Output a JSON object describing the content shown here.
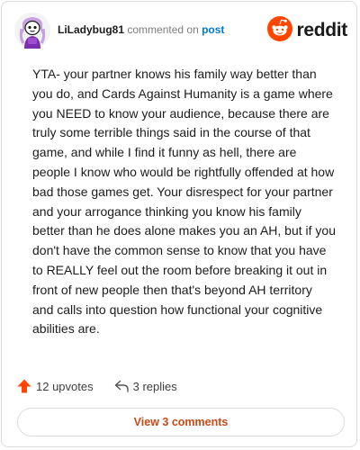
{
  "comment": {
    "username": "LiLadybug81",
    "action_text": "commented on",
    "post_link": "post",
    "text": "YTA- your partner knows his family way better than you do, and Cards Against Humanity is a game where you NEED to know your audience, because there are truly some terrible things said in the course of that game, and while I find it funny as hell, there are people I know who would be rightfully offended at how bad those games get. Your disrespect for your partner and your arrogance thinking you know his family better than he does alone makes you an AH, but if you don't have the common sense to know that you have to REALLY feel out the room before breaking it out in front of new people then that's beyond AH territory and calls into question how functional your cognitive abilities are."
  },
  "brand": {
    "wordmark": "reddit",
    "color": "#ff4500"
  },
  "stats": {
    "upvotes": "12 upvotes",
    "replies": "3 replies"
  },
  "actions": {
    "view_comments": "View 3 comments"
  },
  "icons": {
    "avatar": "snoo-avatar",
    "logo": "reddit-snoo-logo",
    "upvote": "upvote-arrow-icon",
    "reply": "reply-icon"
  },
  "colors": {
    "link": "#0079d3",
    "upvote": "#ff4500",
    "view_button_text": "#c84a15"
  }
}
